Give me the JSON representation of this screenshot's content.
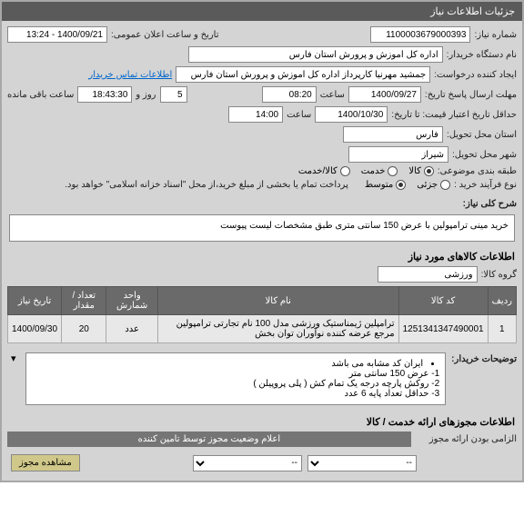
{
  "panel": {
    "title": "جزئیات اطلاعات نیاز"
  },
  "labels": {
    "need_no": "شماره نیاز:",
    "announce": "تاریخ و ساعت اعلان عمومی:",
    "buyer_org": "نام دستگاه خریدار:",
    "requester": "ایجاد کننده درخواست:",
    "contact_link": "اطلاعات تماس خریدار",
    "deadline": "مهلت ارسال پاسخ تاریخ:",
    "hour": "ساعت",
    "day_and": "روز و",
    "remaining": "ساعت باقی مانده",
    "validity": "حداقل تاریخ اعتبار قیمت: تا تاریخ:",
    "province": "استان محل تحویل:",
    "city": "شهر محل تحویل:",
    "category": "طبقه بندی موضوعی:",
    "goods": "کالا",
    "service": "خدمت",
    "both": "کالا/خدمت",
    "purchase_type": "نوع فرآیند خرید :",
    "small": "جزئی",
    "medium": "متوسط",
    "payment_note": "پرداخت تمام یا بخشی از مبلغ خرید،از محل \"اسناد خزانه اسلامی\" خواهد بود.",
    "desc_title": "شرح کلی نیاز:",
    "items_title": "اطلاعات کالاهای مورد نیاز",
    "goods_group": "گروه کالا:",
    "buyer_notes": "توضیحات خریدار:",
    "permits_title": "اطلاعات مجوزهای ارائه خدمت / کالا",
    "mandatory": "الزامی بودن ارائه مجوز",
    "supplier_status": "اعلام وضعیت مجوز توسط تامین کننده",
    "view_permit": "مشاهده مجوز"
  },
  "values": {
    "need_no": "1100003679000393",
    "announce": "1400/09/21 - 13:24",
    "buyer_org": "اداره کل اموزش و پرورش استان فارس",
    "requester": "جمشید مهرنیا کارپرداز اداره کل اموزش و پرورش استان فارس",
    "deadline_date": "1400/09/27",
    "deadline_time": "08:20",
    "days": "5",
    "remaining_time": "18:43:30",
    "validity_date": "1400/10/30",
    "validity_time": "14:00",
    "province": "فارس",
    "city": "شیراز",
    "goods_group": "ورزشی",
    "description": "خرید مینی ترامپولین با عرض 150 سانتی متری طبق مشخصات لیست پیوست"
  },
  "table": {
    "headers": {
      "row": "ردیف",
      "code": "کد کالا",
      "name": "نام کالا",
      "unit": "واحد شمارش",
      "qty": "تعداد / مقدار",
      "date": "تاریخ نیاز"
    },
    "rows": [
      {
        "idx": "1",
        "code": "1251341347490001",
        "name": "ترامپلین ژیمناستیک ورزشی مدل 100 نام تجارتی ترامپولین مرجع عرضه کننده نوآوران توان بخش",
        "unit": "عدد",
        "qty": "20",
        "date": "1400/09/30"
      }
    ]
  },
  "notes": {
    "intro": "ایران کد مشابه می باشد",
    "items": [
      "1- عرض 150 سانتی متر",
      "2- روکش پارچه درجه یک تمام کش ( پلی پروپیلن )",
      "3- حداقل تعداد پایه 6 عدد"
    ]
  },
  "select": {
    "placeholder": "--"
  }
}
